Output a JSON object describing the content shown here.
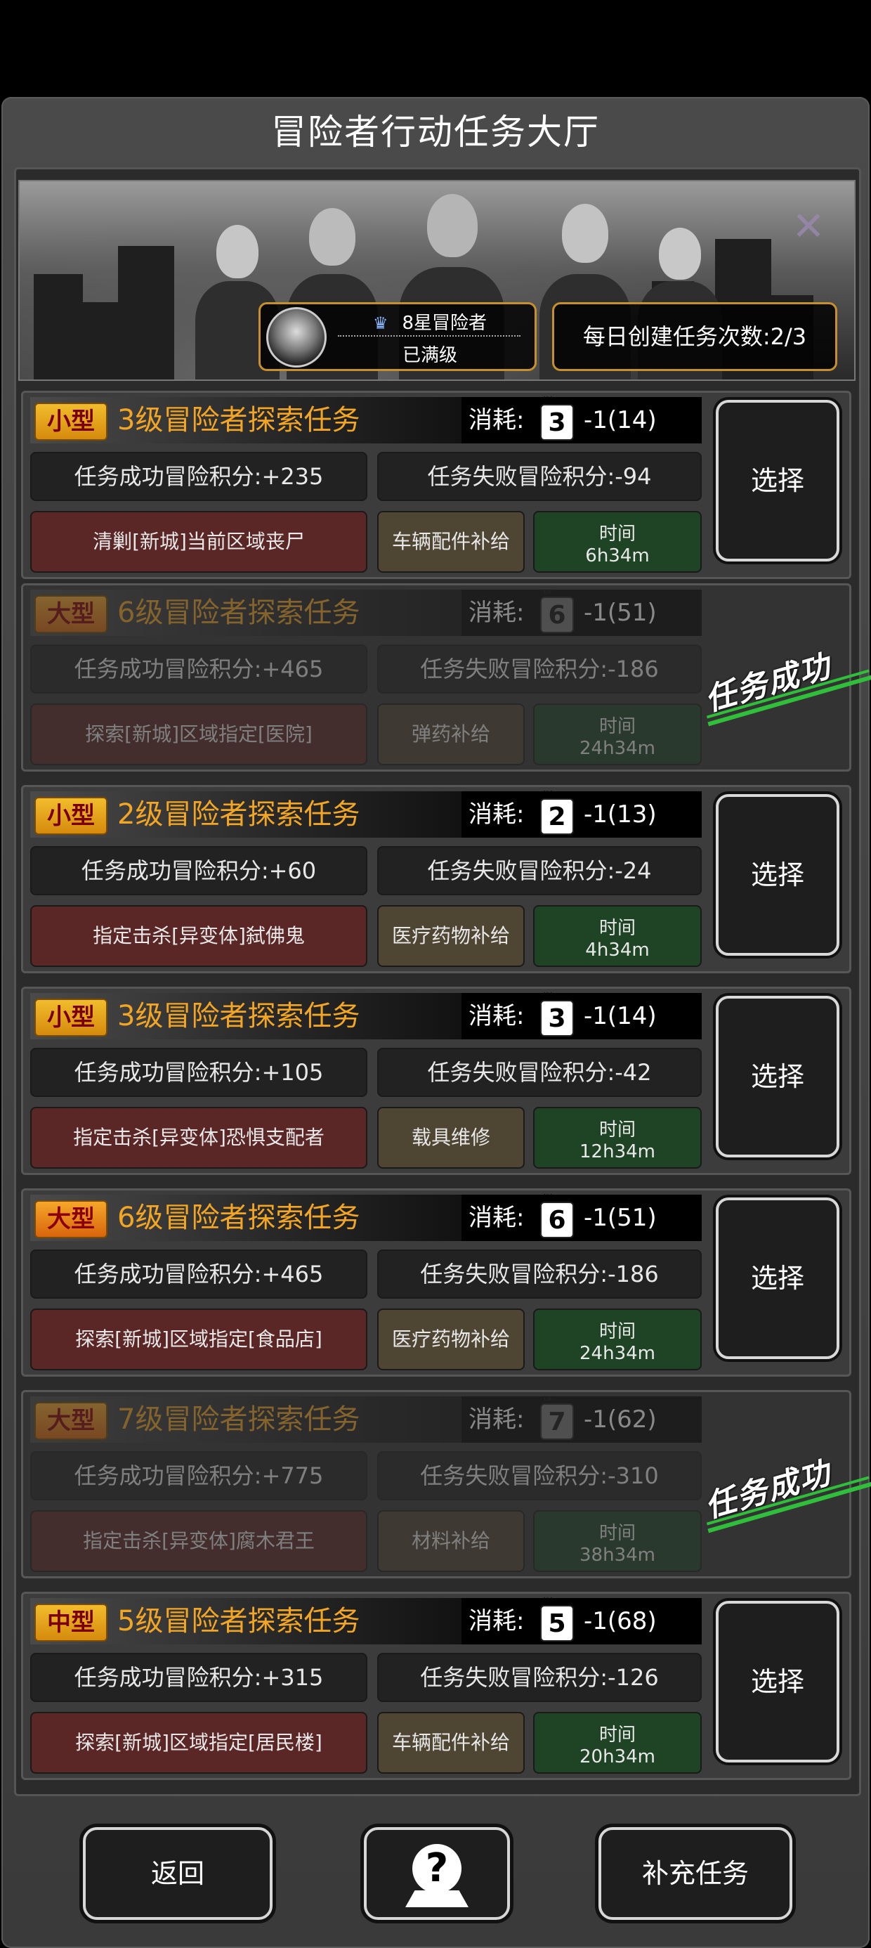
{
  "title": "冒险者行动任务大厅",
  "rank": {
    "title": "8星冒险者",
    "status": "已满级",
    "crown": "♛"
  },
  "daily": "每日创建任务次数:2/3",
  "cost_label": "消耗:",
  "select_label": "选择",
  "completed_label": "任务成功",
  "time_label": "时间",
  "missions": [
    {
      "size": "小型",
      "name": "3级冒险者探索任务",
      "level": "3",
      "cost": "-1(14)",
      "success": "任务成功冒险积分:+235",
      "fail": "任务失败冒险积分:-94",
      "desc": "清剿[新城]当前区域丧尸",
      "supply": "车辆配件补给",
      "time": "6h34m",
      "completed": false
    },
    {
      "size": "大型",
      "name": "6级冒险者探索任务",
      "level": "6",
      "cost": "-1(51)",
      "success": "任务成功冒险积分:+465",
      "fail": "任务失败冒险积分:-186",
      "desc": "探索[新城]区域指定[医院]",
      "supply": "弹药补给",
      "time": "24h34m",
      "completed": true
    },
    {
      "size": "小型",
      "name": "2级冒险者探索任务",
      "level": "2",
      "cost": "-1(13)",
      "success": "任务成功冒险积分:+60",
      "fail": "任务失败冒险积分:-24",
      "desc": "指定击杀[异变体]弑佛鬼",
      "supply": "医疗药物补给",
      "time": "4h34m",
      "completed": false
    },
    {
      "size": "小型",
      "name": "3级冒险者探索任务",
      "level": "3",
      "cost": "-1(14)",
      "success": "任务成功冒险积分:+105",
      "fail": "任务失败冒险积分:-42",
      "desc": "指定击杀[异变体]恐惧支配者",
      "supply": "载具维修",
      "time": "12h34m",
      "completed": false
    },
    {
      "size": "大型",
      "name": "6级冒险者探索任务",
      "level": "6",
      "cost": "-1(51)",
      "success": "任务成功冒险积分:+465",
      "fail": "任务失败冒险积分:-186",
      "desc": "探索[新城]区域指定[食品店]",
      "supply": "医疗药物补给",
      "time": "24h34m",
      "completed": false
    },
    {
      "size": "大型",
      "name": "7级冒险者探索任务",
      "level": "7",
      "cost": "-1(62)",
      "success": "任务成功冒险积分:+775",
      "fail": "任务失败冒险积分:-310",
      "desc": "指定击杀[异变体]腐木君王",
      "supply": "材料补给",
      "time": "38h34m",
      "completed": true
    },
    {
      "size": "中型",
      "name": "5级冒险者探索任务",
      "level": "5",
      "cost": "-1(68)",
      "success": "任务成功冒险积分:+315",
      "fail": "任务失败冒险积分:-126",
      "desc": "探索[新城]区域指定[居民楼]",
      "supply": "车辆配件补给",
      "time": "20h34m",
      "completed": false
    }
  ],
  "buttons": {
    "back": "返回",
    "help_icon": "help-location-icon",
    "refill": "补充任务"
  }
}
